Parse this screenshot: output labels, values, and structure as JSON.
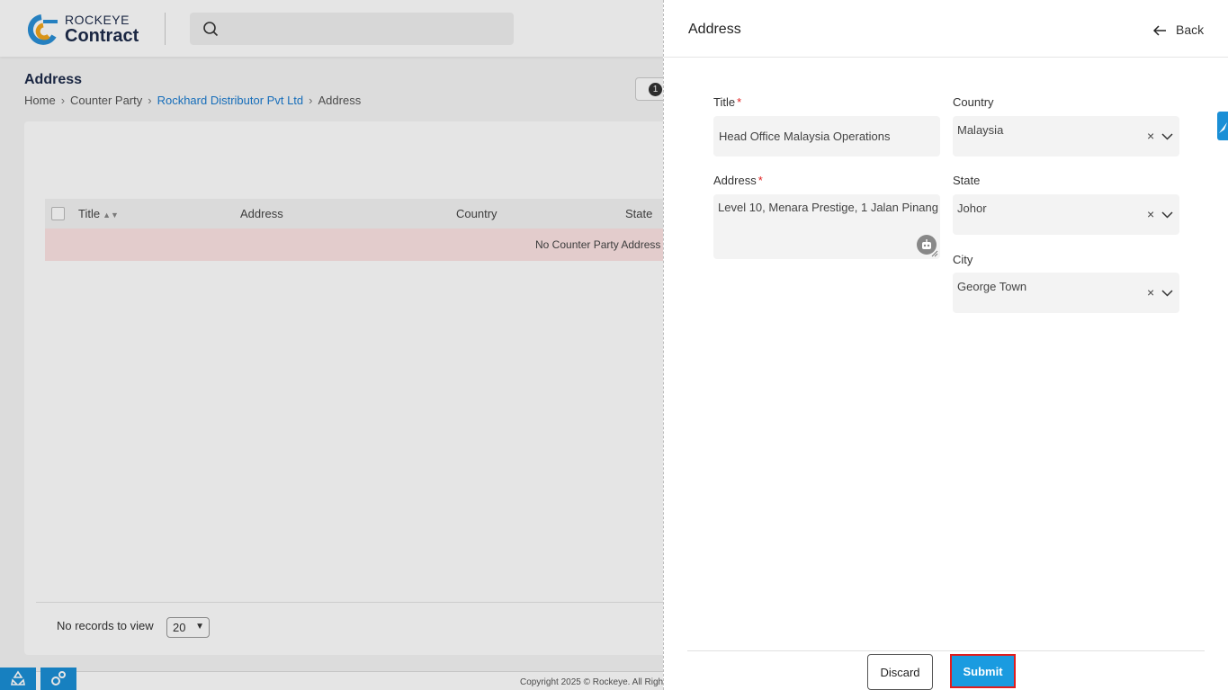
{
  "app": {
    "logo_small": "ROCKEYE",
    "logo_big": "Contract"
  },
  "page": {
    "title": "Address",
    "breadcrumb": [
      "Home",
      "Counter Party",
      "Rockhard Distributor Pvt Ltd",
      "Address"
    ],
    "count_badge": "1"
  },
  "table": {
    "columns": [
      "Title",
      "Address",
      "Country",
      "State"
    ],
    "empty_message": "No Counter Party Address",
    "footer_text": "No records to view",
    "page_size": "20"
  },
  "footer": {
    "copyright": "Copyright 2025 © Rockeye. All Righ"
  },
  "drawer": {
    "title": "Address",
    "back_label": "Back",
    "fields": {
      "title_label": "Title",
      "title_value": "Head Office Malaysia Operations",
      "address_label": "Address",
      "address_value": "Level 10, Menara Prestige, 1 Jalan Pinang",
      "country_label": "Country",
      "country_value": "Malaysia",
      "state_label": "State",
      "state_value": "Johor",
      "city_label": "City",
      "city_value": "George Town"
    },
    "required_mark": "*",
    "clear_glyph": "×",
    "discard_label": "Discard",
    "submit_label": "Submit"
  },
  "colors": {
    "accent": "#1a9be0",
    "link": "#1a7bd0",
    "required": "#e02020",
    "highlight_border": "#e11d1d"
  }
}
